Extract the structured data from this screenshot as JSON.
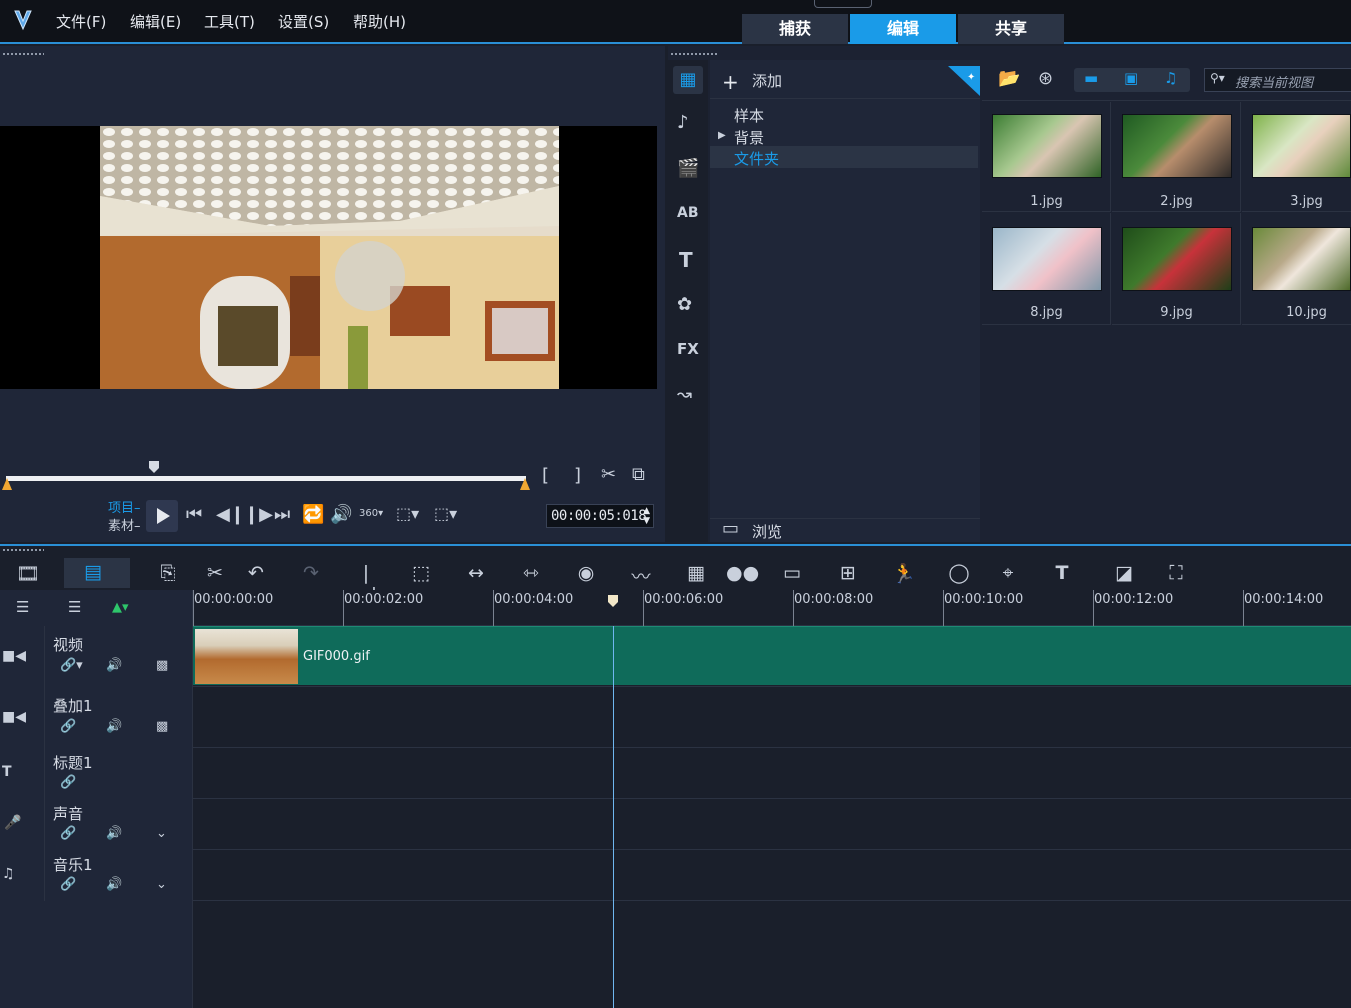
{
  "menu": {
    "file": "文件(F)",
    "edit": "编辑(E)",
    "tools": "工具(T)",
    "settings": "设置(S)",
    "help": "帮助(H)"
  },
  "modes": {
    "capture": "捕获",
    "edit": "编辑",
    "share": "共享"
  },
  "preview": {
    "project_label": "项目",
    "clip_label": "素材",
    "timecode": "00:00:05:018"
  },
  "library": {
    "add_label": "添加",
    "tree": [
      "样本",
      "背景",
      "文件夹"
    ],
    "browse_label": "浏览",
    "search_placeholder": "搜索当前视图",
    "thumbs": [
      "1.jpg",
      "2.jpg",
      "3.jpg",
      "8.jpg",
      "9.jpg",
      "10.jpg"
    ]
  },
  "timeline": {
    "ruler": [
      "00:00:00:00",
      "00:00:02:00",
      "00:00:04:00",
      "00:00:06:00",
      "00:00:08:00",
      "00:00:10:00",
      "00:00:12:00",
      "00:00:14:00"
    ],
    "tracks": [
      "视频",
      "叠加1",
      "标题1",
      "声音",
      "音乐1"
    ],
    "clip_name": "GIF000.gif"
  },
  "colors": {
    "accent": "#1a9be8",
    "clip": "#0f6b5a",
    "background": "#1a1f2b"
  }
}
